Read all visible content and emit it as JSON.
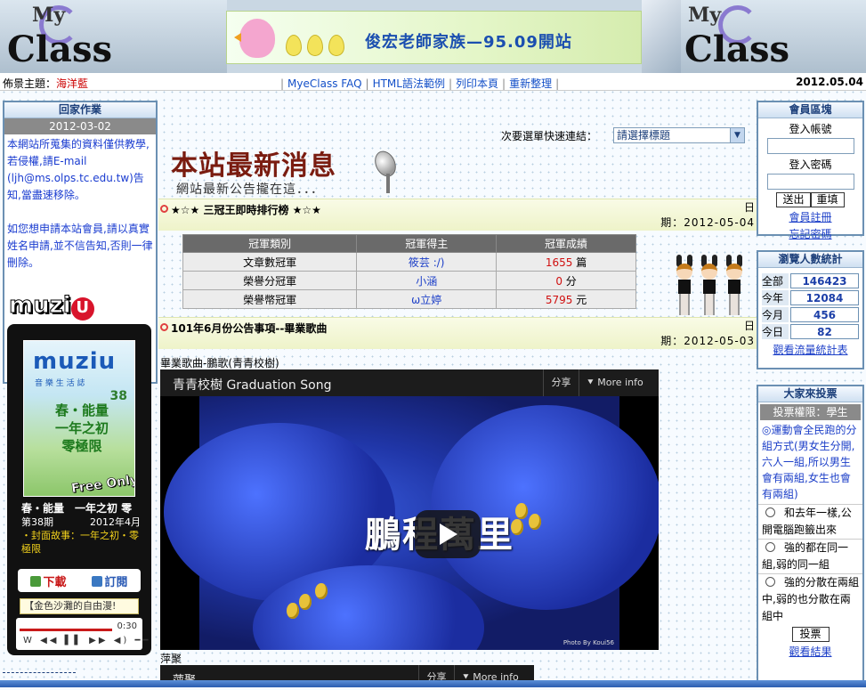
{
  "header": {
    "logo_left": {
      "my": "My",
      "class": "Class"
    },
    "logo_right": {
      "my": "My",
      "class": "Class"
    },
    "banner_title": "俊宏老師家族—95.09開站"
  },
  "toolbar": {
    "theme_label": "佈景主題：",
    "theme_value": "海洋藍",
    "nav": [
      "MyeClass FAQ",
      "HTML語法範例",
      "列印本頁",
      "重新整理"
    ],
    "date": "2012.05.04"
  },
  "homework": {
    "title": "回家作業",
    "date": "2012-03-02",
    "paragraphs": [
      "本網站所蒐集的資料僅供教學,若侵權,請E-mail (ljh@ms.olps.tc.edu.tw)告知,當盡速移除。",
      "如您想申請本站會員,請以真實姓名申請,並不信告知,否則一律刪除。"
    ]
  },
  "muzio": {
    "logo": "muzi",
    "logo_u": "U",
    "mag_title": "muziu",
    "mag_sub": "音 樂 生 活 誌",
    "mag_issue": "38",
    "mag_headline": "春・能量\n一年之初\n零極限",
    "free_only": "Free Only",
    "head": "春・能量　一年之初 零",
    "issue": "第38期",
    "month": "2012年4月",
    "story": "・封面故事：一年之初・零極限",
    "download": "下載",
    "subscribe": "訂閱",
    "song": "【金色沙灘的自由漫!",
    "time": "0:30"
  },
  "main": {
    "quick_link_label": "次要選單快速連結：",
    "quick_select": "請選擇標題",
    "news_title": "本站最新消息",
    "news_sub": "網站最新公告攏在這．．．",
    "posts": [
      {
        "title": "★☆★ 三冠王即時排行榜 ★☆★",
        "date_lbl1": "日",
        "date": "期：2012-05-04"
      },
      {
        "title": "101年6月份公告事項--畢業歌曲",
        "date_lbl1": "日",
        "date": "期：2012-05-03"
      }
    ],
    "champ_table": {
      "headers": [
        "冠軍類別",
        "冠軍得主",
        "冠軍成績"
      ],
      "rows": [
        {
          "category": "文章數冠軍",
          "winner": "筱芸 :/)",
          "score": "1655",
          "unit": "篇"
        },
        {
          "category": "榮譽分冠軍",
          "winner": "小涵",
          "score": "0",
          "unit": "分"
        },
        {
          "category": "榮譽幣冠軍",
          "winner": "ω立婷",
          "score": "5795",
          "unit": "元"
        }
      ]
    },
    "song_label": "畢業歌曲-鵬歌(青青校樹)",
    "video": {
      "title": "青青校樹 Graduation Song",
      "share": "分享",
      "more": "More info",
      "caption": "鵬程萬里",
      "credit": "Photo By Koui56"
    },
    "second_label": "萍聚",
    "video2": {
      "title": "萍聚",
      "share": "分享",
      "more": "More info"
    }
  },
  "member": {
    "title": "會員區塊",
    "account_label": "登入帳號",
    "password_label": "登入密碼",
    "submit": "送出",
    "reset": "重填",
    "register": "會員註冊",
    "forgot": "忘記密碼"
  },
  "stats": {
    "title": "瀏覽人數統計",
    "rows": [
      {
        "label": "全部",
        "value": "146423"
      },
      {
        "label": "今年",
        "value": "12084"
      },
      {
        "label": "今月",
        "value": "456"
      },
      {
        "label": "今日",
        "value": "82"
      }
    ],
    "link": "觀看流量統計表"
  },
  "vote": {
    "title": "大家來投票",
    "permission": "投票權限：學生",
    "question": "◎運動會全民跑的分組方式(男女生分開,六人一組,所以男生會有兩組,女生也會有兩組)",
    "options": [
      "和去年一樣,公開電腦跑籤出來",
      "強的都在同一組,弱的同一組",
      "強的分散在兩組中,弱的也分散在兩組中"
    ],
    "submit": "投票",
    "results": "觀看結果"
  }
}
